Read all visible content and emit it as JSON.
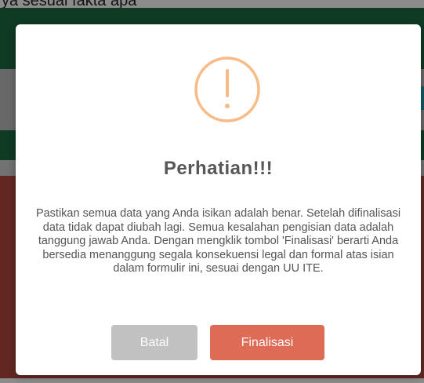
{
  "background": {
    "top_text": "ya sesuai fakta apa"
  },
  "dialog": {
    "icon": "exclamation-circle-icon",
    "icon_color": "#f8bb86",
    "title": "Perhatian!!!",
    "message": "Pastikan semua data yang Anda isikan adalah benar. Setelah difinalisasi data tidak dapat diubah lagi. Semua kesalahan pengisian data adalah tanggung jawab Anda. Dengan mengklik tombol 'Finalisasi' berarti Anda bersedia menanggung segala konsekuensi legal dan formal atas isian dalam formulir ini, sesuai dengan UU ITE.",
    "cancel_label": "Batal",
    "confirm_label": "Finalisasi",
    "cancel_color": "#c1c1c1",
    "confirm_color": "#dd6b55"
  }
}
